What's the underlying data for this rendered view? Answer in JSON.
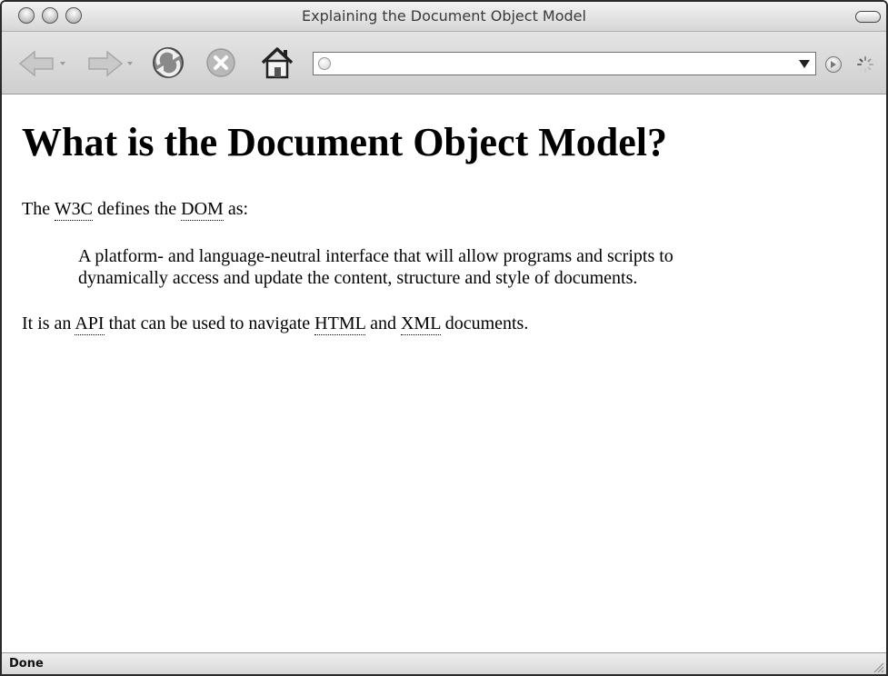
{
  "window": {
    "title": "Explaining the Document Object Model"
  },
  "toolbar": {
    "back_icon": "back-arrow-icon",
    "forward_icon": "forward-arrow-icon",
    "reload_icon": "reload-icon",
    "stop_icon": "stop-icon",
    "home_icon": "home-icon",
    "address": {
      "value": "",
      "placeholder": ""
    }
  },
  "content": {
    "heading": "What is the Document Object Model?",
    "p1": {
      "part1": "The ",
      "w3c": "W3C",
      "part2": " defines the ",
      "dom": "DOM",
      "part3": " as:"
    },
    "quote": {
      "line1": "A platform- and language-neutral interface that will allow programs and scripts to",
      "line2": "dynamically access and update the content, structure and style of documents."
    },
    "p2": {
      "part1": "It is an ",
      "api": "API",
      "part2": " that can be used to navigate ",
      "html": "HTML",
      "part3": " and ",
      "xml": "XML",
      "part4": " documents."
    }
  },
  "status": {
    "text": "Done"
  },
  "colors": {
    "chrome_light": "#e4e4e4",
    "chrome_dark": "#cfcfcf",
    "text": "#000000"
  }
}
